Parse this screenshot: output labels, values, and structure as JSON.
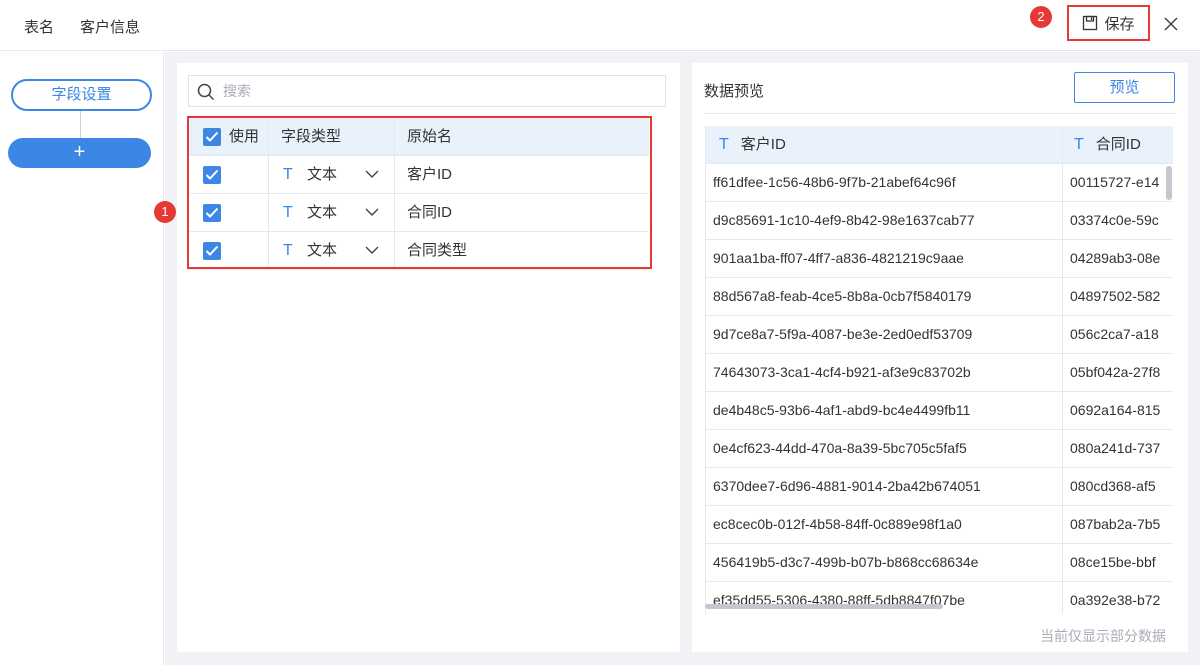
{
  "header": {
    "table_label": "表名",
    "table_name": "客户信息",
    "save_label": "保存",
    "badge_save": "2"
  },
  "rail": {
    "field_settings": "字段设置",
    "add": "+"
  },
  "search": {
    "placeholder": "搜索"
  },
  "field_table": {
    "badge": "1",
    "headers": {
      "use": "使用",
      "type": "字段类型",
      "name": "原始名"
    },
    "rows": [
      {
        "checked": true,
        "type_icon": "T",
        "type": "文本",
        "name": "客户ID"
      },
      {
        "checked": true,
        "type_icon": "T",
        "type": "文本",
        "name": "合同ID"
      },
      {
        "checked": true,
        "type_icon": "T",
        "type": "文本",
        "name": "合同类型"
      }
    ]
  },
  "preview": {
    "title": "数据预览",
    "button": "预览",
    "columns": [
      {
        "icon": "T",
        "name": "客户ID"
      },
      {
        "icon": "T",
        "name": "合同ID"
      }
    ],
    "rows": [
      [
        "ff61dfee-1c56-48b6-9f7b-21abef64c96f",
        "00115727-e14"
      ],
      [
        "d9c85691-1c10-4ef9-8b42-98e1637cab77",
        "03374c0e-59c"
      ],
      [
        "901aa1ba-ff07-4ff7-a836-4821219c9aae",
        "04289ab3-08e"
      ],
      [
        "88d567a8-feab-4ce5-8b8a-0cb7f5840179",
        "04897502-582"
      ],
      [
        "9d7ce8a7-5f9a-4087-be3e-2ed0edf53709",
        "056c2ca7-a18"
      ],
      [
        "74643073-3ca1-4cf4-b921-af3e9c83702b",
        "05bf042a-27f8"
      ],
      [
        "de4b48c5-93b6-4af1-abd9-bc4e4499fb11",
        "0692a164-815"
      ],
      [
        "0e4cf623-44dd-470a-8a39-5bc705c5faf5",
        "080a241d-737"
      ],
      [
        "6370dee7-6d96-4881-9014-2ba42b674051",
        "080cd368-af5"
      ],
      [
        "ec8cec0b-012f-4b58-84ff-0c889e98f1a0",
        "087bab2a-7b5"
      ],
      [
        "456419b5-d3c7-499b-b07b-b868cc68634e",
        "08ce15be-bbf"
      ],
      [
        "ef35dd55-5306-4380-88ff-5db8847f07be",
        "0a392e38-b72"
      ]
    ],
    "footnote": "当前仅显示部分数据"
  },
  "colors": {
    "accent": "#3c86e6",
    "highlight": "#e53935",
    "header_bg": "#e9f1fb",
    "panel_bg": "#f0f2f5"
  }
}
